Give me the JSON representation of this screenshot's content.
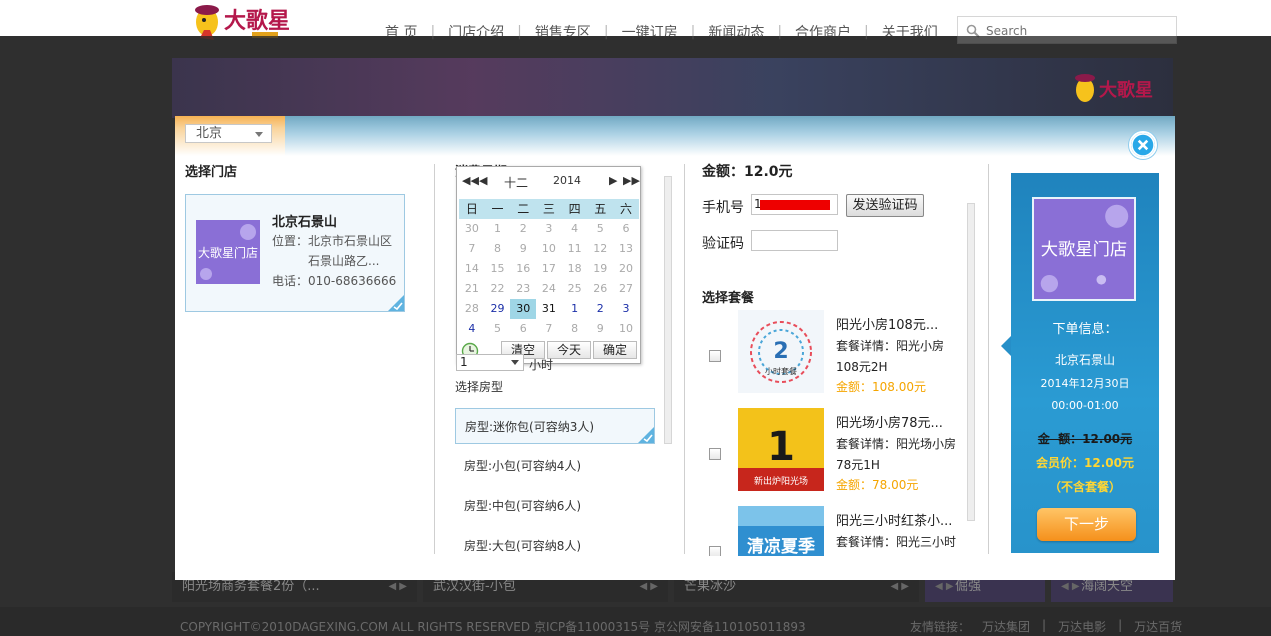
{
  "header": {
    "nav": [
      "首 页",
      "门店介绍",
      "销售专区",
      "一键订房",
      "新闻动态",
      "合作商户",
      "关于我们"
    ],
    "search_placeholder": "Search"
  },
  "background": {
    "thumbs": [
      "阳光场商务套餐2份（...",
      "武汉汉街-小包",
      "芒果冰沙",
      "倔强",
      "海阔天空"
    ]
  },
  "footer": {
    "copyright": "COPYRIGHT©2010DAGEXING.COM ALL RIGHTS RESERVED 京ICP备11000315号 京公网安备110105011893",
    "links_label": "友情链接：",
    "links": [
      "万达集团",
      "万达电影",
      "万达百货"
    ]
  },
  "modal": {
    "city": "北京",
    "store_section": {
      "title": "选择门店",
      "store": {
        "image_text": "大歌星门店",
        "name": "北京石景山",
        "address_line1": "位置：北京市石景山区",
        "address_line2": "石景山路乙...",
        "phone": "电话：010-68636666"
      }
    },
    "date_section": {
      "title": "消费日期",
      "calendar": {
        "month": "十二",
        "year": "2014",
        "weekdays": [
          "日",
          "一",
          "二",
          "三",
          "四",
          "五",
          "六"
        ],
        "rows": [
          [
            "30",
            "1",
            "2",
            "3",
            "4",
            "5",
            "6"
          ],
          [
            "7",
            "8",
            "9",
            "10",
            "11",
            "12",
            "13"
          ],
          [
            "14",
            "15",
            "16",
            "17",
            "18",
            "19",
            "20"
          ],
          [
            "21",
            "22",
            "23",
            "24",
            "25",
            "26",
            "27"
          ],
          [
            "28",
            "29",
            "30",
            "31",
            "1",
            "2",
            "3"
          ],
          [
            "4",
            "5",
            "6",
            "7",
            "8",
            "9",
            "10"
          ]
        ],
        "selected": "30",
        "clear_label": "清空",
        "today_label": "今天",
        "ok_label": "确定"
      },
      "time_value": "1",
      "time_unit": "小时",
      "room_label": "选择房型",
      "rooms": [
        "房型:迷你包(可容纳3人)",
        "房型:小包(可容纳4人)",
        "房型:中包(可容纳6人)",
        "房型:大包(可容纳8人)"
      ]
    },
    "payment": {
      "amount": "金额：12.0元",
      "phone_label": "手机号",
      "phone_value": "1",
      "send_code": "发送验证码",
      "code_label": "验证码",
      "package_title": "选择套餐",
      "packages": [
        {
          "name": "阳光小房108元...",
          "detail1": "套餐详情：阳光小房",
          "detail2": "108元2H",
          "price": "金额：108.00元",
          "image_caption": "小时套餐",
          "image_number": "2"
        },
        {
          "name": "阳光场小房78元...",
          "detail1": "套餐详情：阳光场小房",
          "detail2": "78元1H",
          "price": "金额：78.00元",
          "image_caption": "新出炉阳光场",
          "image_number": "1"
        },
        {
          "name": "阳光三小时红茶小...",
          "detail1": "套餐详情：阳光三小时",
          "detail2": "",
          "price": "",
          "image_caption": "清凉夏季",
          "image_number": ""
        }
      ]
    },
    "summary": {
      "image_text": "大歌星门店",
      "heading": "下单信息：",
      "store": "北京石景山",
      "date": "2014年12月30日",
      "time": "00:00-01:00",
      "original_price": "金  额：12.00元",
      "member_price": "会员价：12.00元",
      "note": "（不含套餐）",
      "next_label": "下一步"
    }
  },
  "colors": {
    "accent_blue": "#29a8e8",
    "price_orange": "#f5a500",
    "member_yellow": "#ffd633",
    "next_orange": "#f5901b"
  }
}
